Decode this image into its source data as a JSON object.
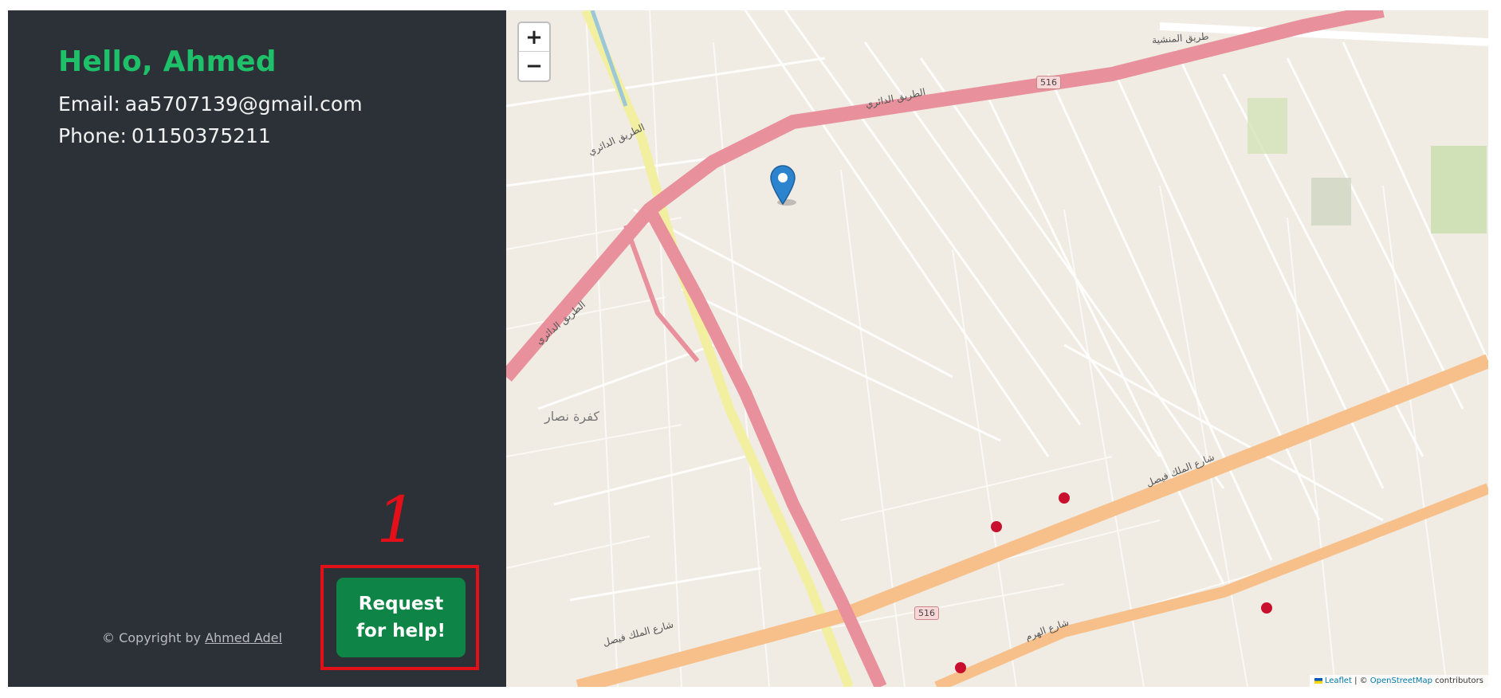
{
  "profile": {
    "greeting": "Hello, Ahmed",
    "email_label": "Email:",
    "email_value": "aa5707139@gmail.com",
    "phone_label": "Phone:",
    "phone_value": "01150375211"
  },
  "actions": {
    "help_button_label": "Request for help!"
  },
  "annotation": {
    "number": "1",
    "color": "#e3101a"
  },
  "footer": {
    "copyright_prefix": "© Copyright by",
    "author_name": "Ahmed Adel"
  },
  "map": {
    "zoom_in_label": "+",
    "zoom_out_label": "−",
    "attribution_leaflet": "Leaflet",
    "attribution_sep": " | © ",
    "attribution_osm": "OpenStreetMap",
    "attribution_suffix": " contributors",
    "labels": {
      "ring_road": "الطريق الدائري",
      "faisal_street": "شارع الملك فيصل",
      "haram_street": "شارع الهرم",
      "kafr_nassar": "كفرة نصار",
      "route_516": "516",
      "manshia": "طريق المنشية"
    }
  },
  "colors": {
    "sidebar_bg": "#2b3137",
    "greeting": "#1ec06a",
    "help_button": "#0e8546",
    "map_bg": "#f0ebe3",
    "ring_road": "#e8909c",
    "major_road": "#f7c08a",
    "canal_road": "#f2f0a0"
  },
  "icons": {
    "map_marker": "map-marker-icon",
    "leaflet_flag": "ukraine-flag-icon"
  }
}
